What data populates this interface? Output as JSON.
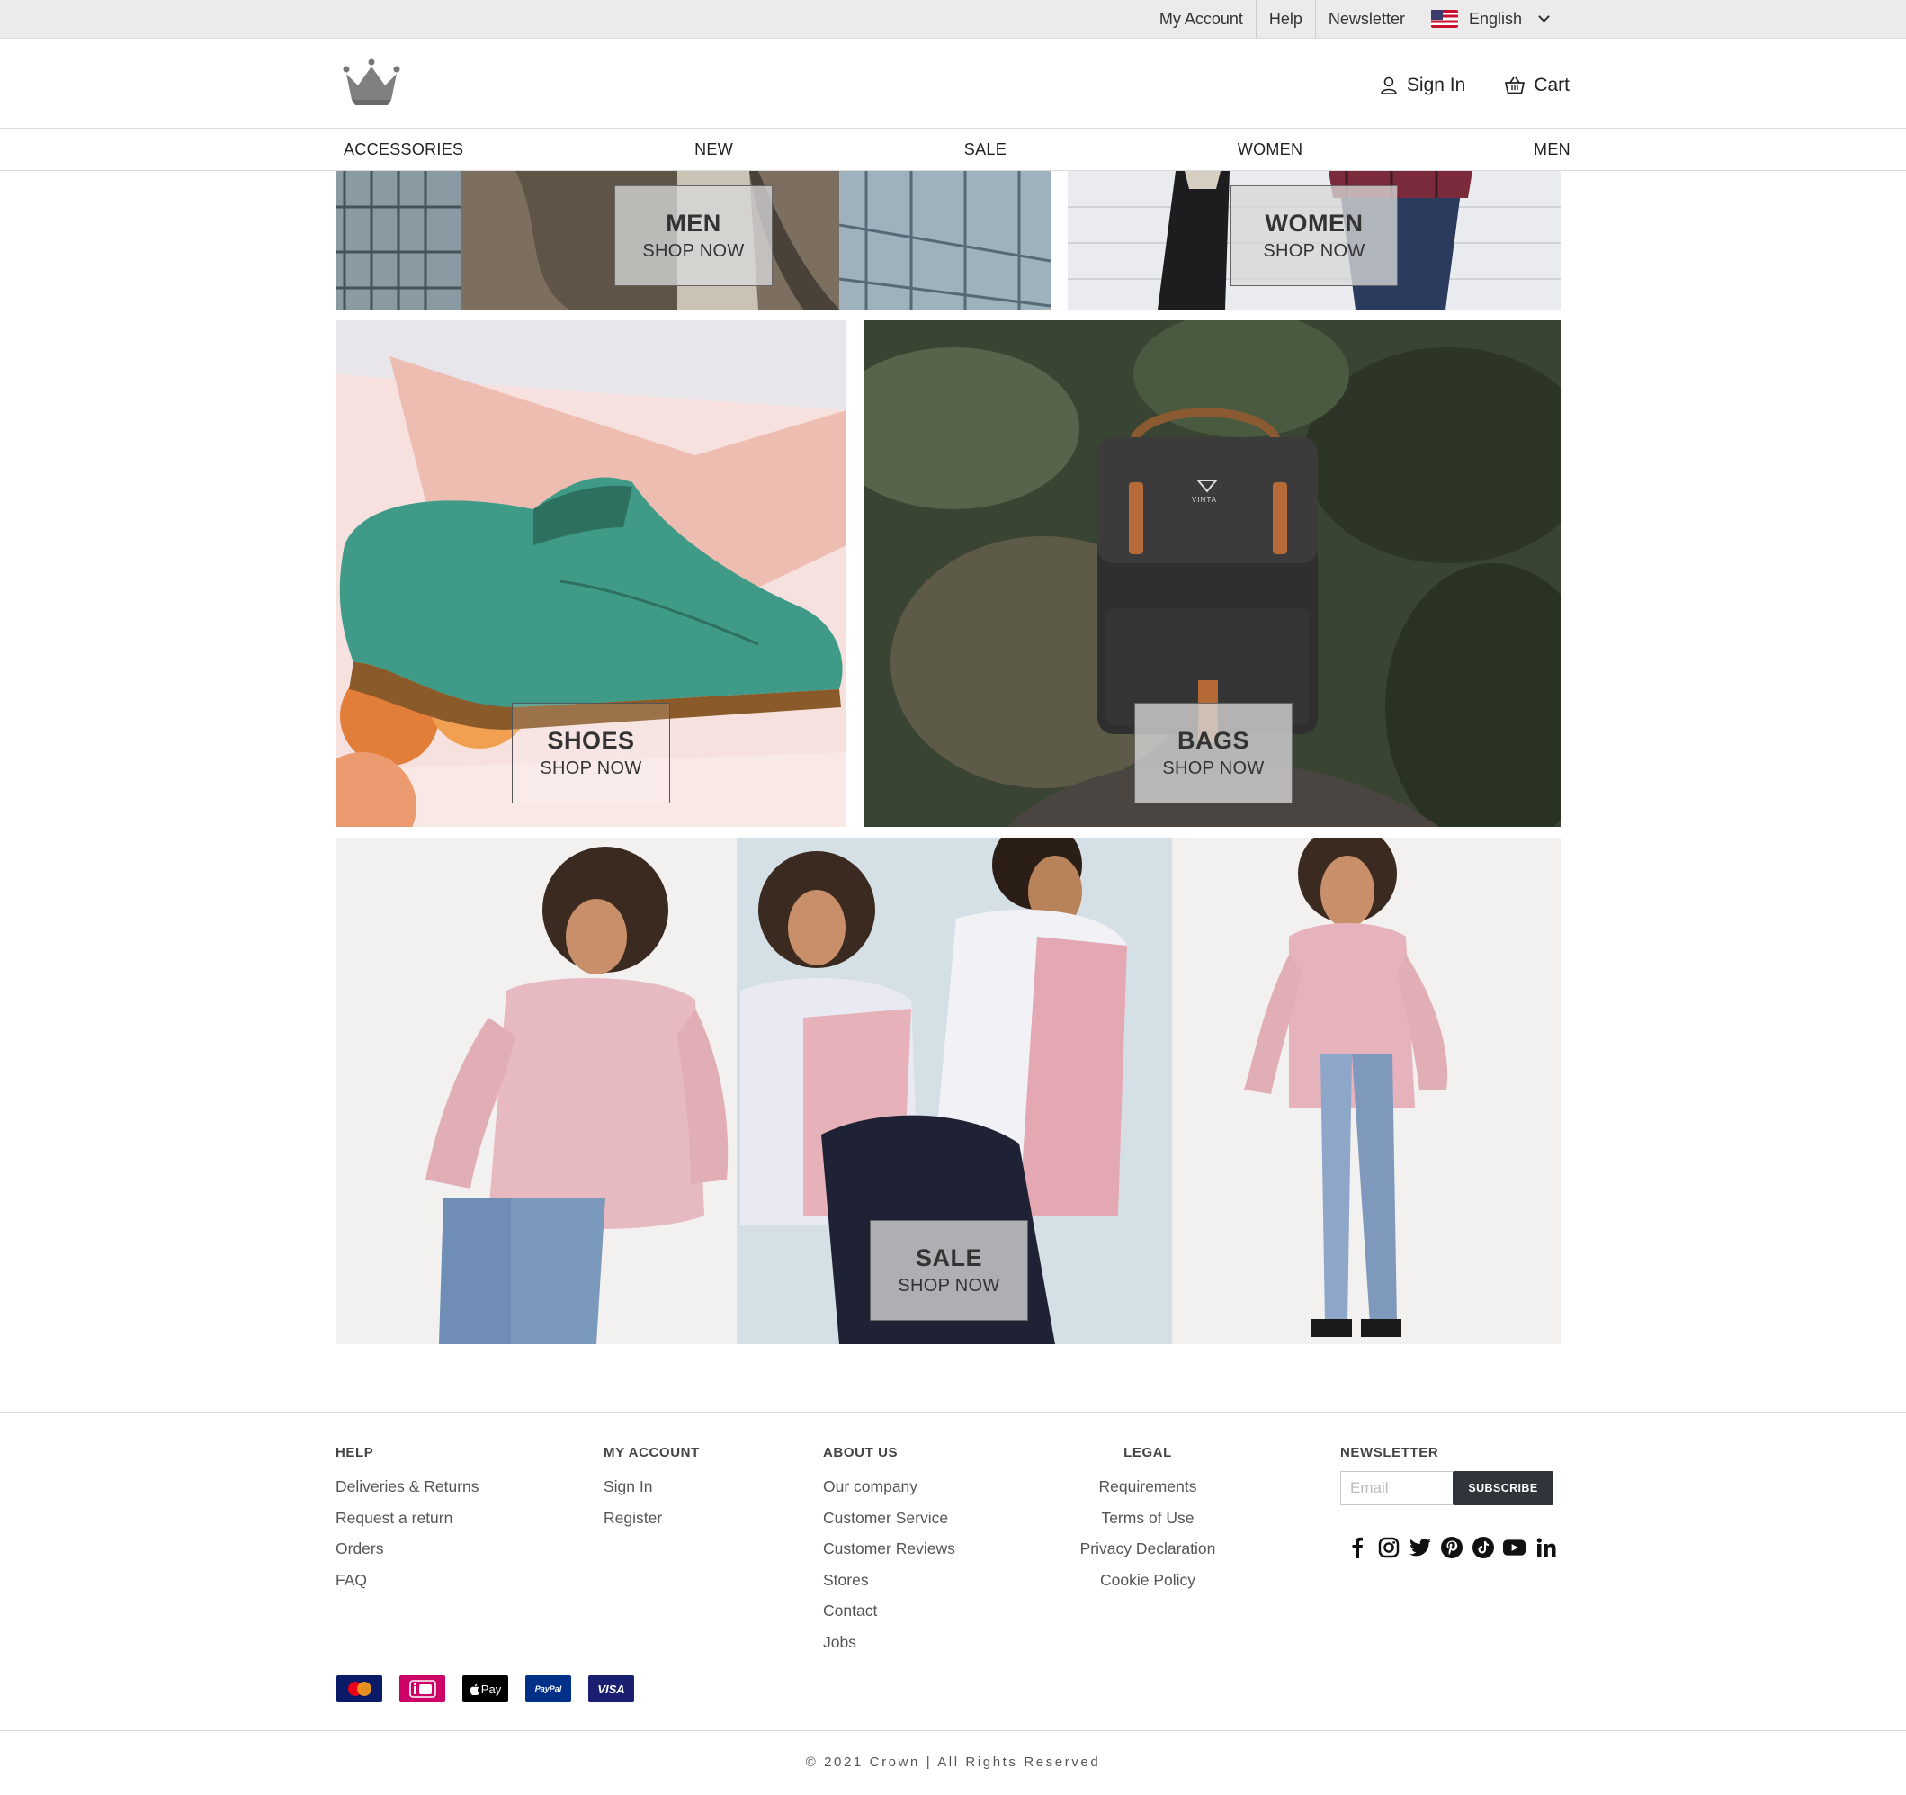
{
  "topbar": {
    "my_account": "My Account",
    "help": "Help",
    "newsletter": "Newsletter",
    "language": "English"
  },
  "header": {
    "sign_in": "Sign In",
    "cart": "Cart"
  },
  "nav": [
    "ACCESSORIES",
    "NEW",
    "SALE",
    "WOMEN",
    "MEN"
  ],
  "tiles": {
    "men": {
      "title": "MEN",
      "cta": "SHOP NOW"
    },
    "women": {
      "title": "WOMEN",
      "cta": "SHOP NOW"
    },
    "shoes": {
      "title": "SHOES",
      "cta": "SHOP NOW"
    },
    "bags": {
      "title": "BAGS",
      "cta": "SHOP NOW",
      "brand": "VINTA"
    },
    "sale": {
      "title": "SALE",
      "cta": "SHOP NOW"
    }
  },
  "footer": {
    "help": {
      "title": "HELP",
      "links": [
        "Deliveries & Returns",
        "Request a return",
        "Orders",
        "FAQ"
      ]
    },
    "account": {
      "title": "MY ACCOUNT",
      "links": [
        "Sign In",
        "Register"
      ]
    },
    "about": {
      "title": "ABOUT US",
      "links": [
        "Our company",
        "Customer Service",
        "Customer Reviews",
        "Stores",
        "Contact",
        "Jobs"
      ]
    },
    "legal": {
      "title": "LEGAL",
      "links": [
        "Requirements",
        "Terms of Use",
        "Privacy Declaration",
        "Cookie Policy"
      ]
    },
    "newsletter": {
      "title": "NEWSLETTER",
      "placeholder": "Email",
      "button": "SUBSCRIBE"
    },
    "social_icons": [
      "facebook-icon",
      "instagram-icon",
      "twitter-icon",
      "pinterest-icon",
      "tiktok-icon",
      "youtube-icon",
      "linkedin-icon"
    ],
    "payments": [
      {
        "name": "mastercard-icon",
        "label": "",
        "color": "#0a1a66"
      },
      {
        "name": "ideal-icon",
        "label": "iDEAL",
        "color": "#cc0066"
      },
      {
        "name": "apple-pay-icon",
        "label": "Pay",
        "color": "#000000"
      },
      {
        "name": "paypal-icon",
        "label": "PayPal",
        "color": "#003087"
      },
      {
        "name": "visa-icon",
        "label": "VISA",
        "color": "#1a1f71"
      }
    ],
    "copyright": "© 2021 Crown | All Rights Reserved"
  },
  "colors": {
    "accent_dark": "#2f353b",
    "topbar_bg": "#ebebeb"
  }
}
